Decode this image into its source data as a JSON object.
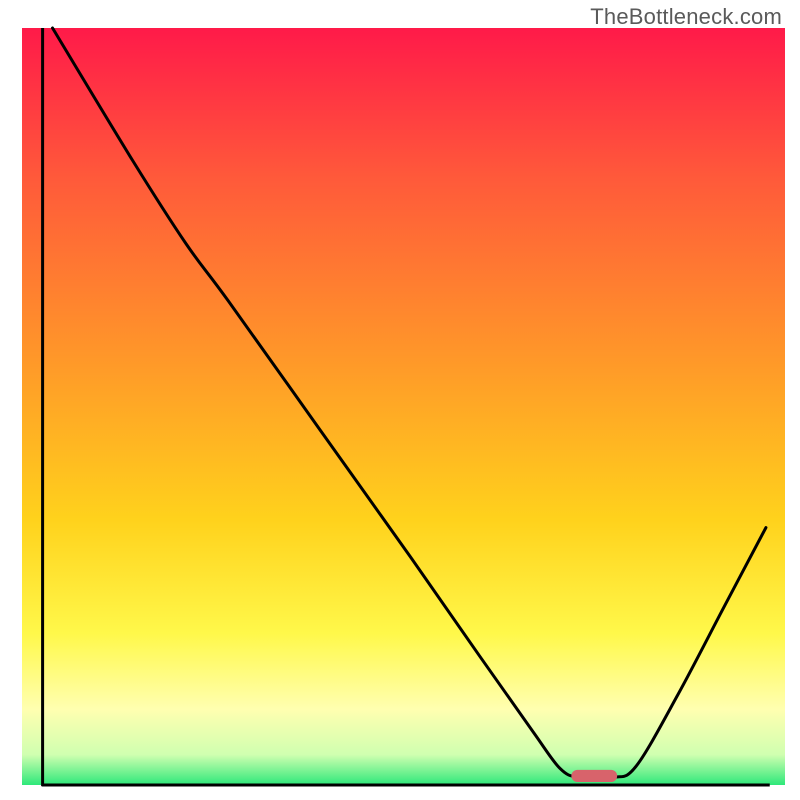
{
  "watermark": "TheBottleneck.com",
  "chart_data": {
    "type": "line",
    "title": "",
    "xlabel": "",
    "ylabel": "",
    "xlim": [
      0,
      100
    ],
    "ylim": [
      0,
      100
    ],
    "gradient_stops": [
      {
        "offset": 0.0,
        "color": "#ff1a49"
      },
      {
        "offset": 0.2,
        "color": "#ff5a3a"
      },
      {
        "offset": 0.45,
        "color": "#ff9b28"
      },
      {
        "offset": 0.65,
        "color": "#ffd21c"
      },
      {
        "offset": 0.8,
        "color": "#fff84a"
      },
      {
        "offset": 0.9,
        "color": "#ffffb0"
      },
      {
        "offset": 0.96,
        "color": "#d0ffb0"
      },
      {
        "offset": 1.0,
        "color": "#2ee87a"
      }
    ],
    "curve": {
      "note": "Approximate path of the black bottleneck curve. x,y in 0-100 plot-space (y=0 at bottom).",
      "points": [
        {
          "x": 4.0,
          "y": 100.0
        },
        {
          "x": 14.5,
          "y": 82.5
        },
        {
          "x": 21.5,
          "y": 71.5
        },
        {
          "x": 27.0,
          "y": 64.0
        },
        {
          "x": 39.0,
          "y": 47.0
        },
        {
          "x": 51.0,
          "y": 30.0
        },
        {
          "x": 60.0,
          "y": 17.0
        },
        {
          "x": 67.0,
          "y": 7.0
        },
        {
          "x": 70.5,
          "y": 2.2
        },
        {
          "x": 73.0,
          "y": 1.0
        },
        {
          "x": 77.5,
          "y": 1.0
        },
        {
          "x": 80.5,
          "y": 2.5
        },
        {
          "x": 86.0,
          "y": 12.0
        },
        {
          "x": 92.0,
          "y": 23.5
        },
        {
          "x": 97.5,
          "y": 34.0
        }
      ]
    },
    "marker": {
      "note": "Small red rounded rectangle marking the optimum near the valley floor.",
      "x": 75.0,
      "y": 1.2,
      "width": 6.0,
      "height": 1.6,
      "color": "#d8636b"
    },
    "axes": {
      "left": {
        "x": 2.7,
        "y0": 0,
        "y1": 100
      },
      "bottom": {
        "y": 0,
        "x0": 2.7,
        "x1": 98.0
      }
    }
  }
}
